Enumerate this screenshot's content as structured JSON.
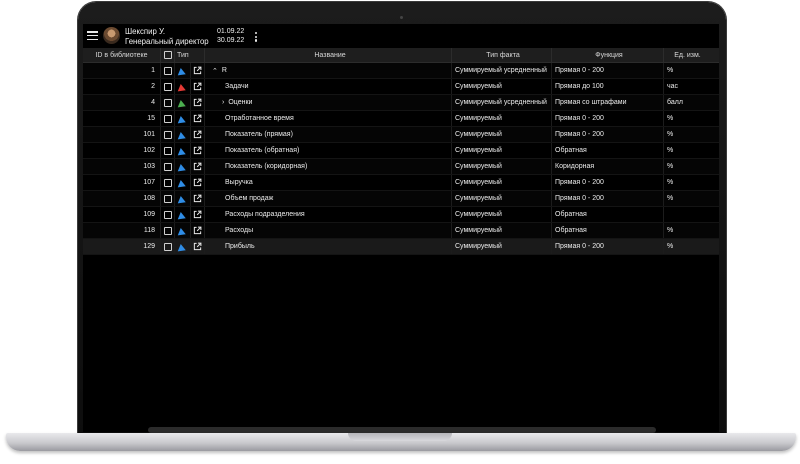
{
  "header": {
    "user_name": "Шекспир У.",
    "user_role": "Генеральный директор",
    "date_from": "01.09.22",
    "date_to": "30.09.22"
  },
  "columns": {
    "id": "ID в библиотеке",
    "type": "Тип",
    "name": "Название",
    "fact_type": "Тип факта",
    "function": "Функция",
    "unit": "Ед. изм."
  },
  "rows": [
    {
      "id": "1",
      "type_color": "blue",
      "expand": "collapse",
      "name": "R",
      "fact_type": "Суммируемый усредненный",
      "function": "Прямая 0 - 200",
      "unit": "%"
    },
    {
      "id": "2",
      "type_color": "red",
      "expand": "",
      "name": "Задачи",
      "fact_type": "Суммируемый",
      "function": "Прямая до 100",
      "unit": "час"
    },
    {
      "id": "4",
      "type_color": "green",
      "expand": "expand",
      "name": "Оценки",
      "fact_type": "Суммируемый усредненный",
      "function": "Прямая со штрафами",
      "unit": "балл"
    },
    {
      "id": "15",
      "type_color": "blue",
      "expand": "",
      "name": "Отработанное время",
      "fact_type": "Суммируемый",
      "function": "Прямая 0 - 200",
      "unit": "%"
    },
    {
      "id": "101",
      "type_color": "blue",
      "expand": "",
      "name": "Показатель (прямая)",
      "fact_type": "Суммируемый",
      "function": "Прямая 0 - 200",
      "unit": "%"
    },
    {
      "id": "102",
      "type_color": "blue",
      "expand": "",
      "name": "Показатель (обратная)",
      "fact_type": "Суммируемый",
      "function": "Обратная",
      "unit": "%"
    },
    {
      "id": "103",
      "type_color": "blue",
      "expand": "",
      "name": "Показатель (коридорная)",
      "fact_type": "Суммируемый",
      "function": "Коридорная",
      "unit": "%"
    },
    {
      "id": "107",
      "type_color": "blue",
      "expand": "",
      "name": "Выручка",
      "fact_type": "Суммируемый",
      "function": "Прямая 0 - 200",
      "unit": "%"
    },
    {
      "id": "108",
      "type_color": "blue",
      "expand": "",
      "name": "Объем продаж",
      "fact_type": "Суммируемый",
      "function": "Прямая 0 - 200",
      "unit": "%"
    },
    {
      "id": "109",
      "type_color": "blue",
      "expand": "",
      "name": "Расходы подразделения",
      "fact_type": "Суммируемый",
      "function": "Обратная",
      "unit": ""
    },
    {
      "id": "118",
      "type_color": "blue",
      "expand": "",
      "name": "Расходы",
      "fact_type": "Суммируемый",
      "function": "Обратная",
      "unit": "%"
    },
    {
      "id": "129",
      "type_color": "blue",
      "expand": "",
      "name": "Прибыль",
      "fact_type": "Суммируемый",
      "function": "Прямая 0 - 200",
      "unit": "%"
    }
  ],
  "colors": {
    "blue": "#2f8de6",
    "red": "#e53935",
    "green": "#4caf50",
    "background": "#000000",
    "header_row": "#1e1e1e"
  }
}
